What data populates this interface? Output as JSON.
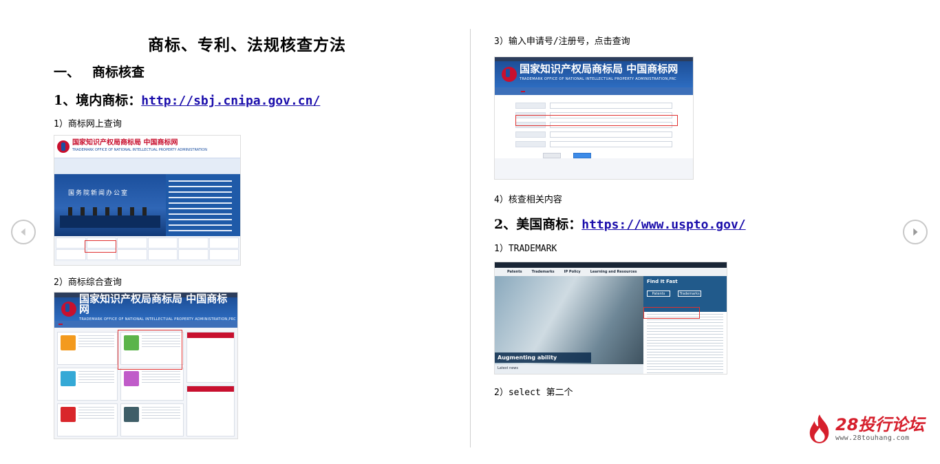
{
  "title": "商标、专利、法规核查方法",
  "section1": {
    "num": "一、",
    "label": "商标核查"
  },
  "domestic": {
    "heading": "1、境内商标：",
    "url": "http://sbj.cnipa.gov.cn/"
  },
  "steps_left": {
    "s1": "1）商标网上查询",
    "s2": "2）商标综合查询"
  },
  "steps_right": {
    "s3": "3）输入申请号/注册号，点击查询",
    "s4": "4）核查相关内容"
  },
  "us": {
    "heading": "2、美国商标：",
    "url": "https://www.uspto.gov/",
    "s1": "1）TRADEMARK",
    "s2": "2）select 第二个"
  },
  "screens": {
    "cnipa_home": {
      "hall_text": "国务院新闻办公室",
      "logo_cn": "国家知识产权局商标局 中国商标网",
      "logo_en": "TRADEMARK OFFICE OF NATIONAL INTELLECTUAL PROPERTY ADMINISTRATION"
    },
    "cnipa_banner": {
      "logo_cn": "国家知识产权局商标局 中国商标网",
      "logo_en": "TRADEMARK OFFICE OF NATIONAL INTELLECTUAL PROPERTY ADMINISTRATION,PRC"
    },
    "uspto": {
      "menu": [
        "Patents",
        "Trademarks",
        "IP Policy",
        "Learning and Resources"
      ],
      "find": "Find It Fast",
      "caption": "Augmenting ability",
      "latest": "Latest news",
      "pills": [
        "Patents",
        "Trademarks"
      ]
    }
  },
  "brand": {
    "name": "28投行论坛",
    "url": "www.28touhang.com"
  },
  "colors": {
    "link": "#1a0dab",
    "accent": "#c8102e",
    "brand": "#d61f2c"
  },
  "icons": [
    "prev-arrow-icon",
    "next-arrow-icon",
    "flame-icon"
  ]
}
